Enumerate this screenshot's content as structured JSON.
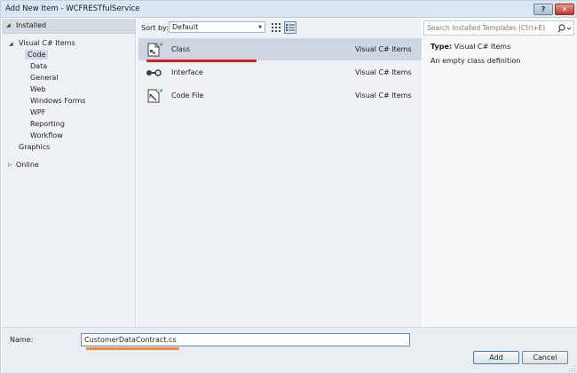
{
  "window": {
    "title": "Add New Item - WCFRESTfulService",
    "help_glyph": "?",
    "close_glyph": "✕"
  },
  "tree": {
    "root": "Installed",
    "items": [
      {
        "label": "Visual C# Items",
        "level": 1,
        "expanded": true
      },
      {
        "label": "Code",
        "level": 2,
        "selected": true
      },
      {
        "label": "Data",
        "level": 2
      },
      {
        "label": "General",
        "level": 2
      },
      {
        "label": "Web",
        "level": 2
      },
      {
        "label": "Windows Forms",
        "level": 2
      },
      {
        "label": "WPF",
        "level": 2
      },
      {
        "label": "Reporting",
        "level": 2
      },
      {
        "label": "Workflow",
        "level": 2
      },
      {
        "label": "Graphics",
        "level": 1
      }
    ],
    "online": "Online"
  },
  "sort": {
    "label": "Sort by:",
    "value": "Default",
    "view_mode": "list"
  },
  "templates": [
    {
      "name": "Class",
      "type": "Visual C# Items",
      "icon": "class-icon",
      "selected": true
    },
    {
      "name": "Interface",
      "type": "Visual C# Items",
      "icon": "interface-icon",
      "selected": false
    },
    {
      "name": "Code File",
      "type": "Visual C# Items",
      "icon": "code-file-icon",
      "selected": false
    }
  ],
  "search": {
    "placeholder": "Search Installed Templates (Ctrl+E)"
  },
  "details": {
    "type_label": "Type:",
    "type_value": "Visual C# Items",
    "description": "An empty class definition"
  },
  "name_field": {
    "label": "Name:",
    "value": "CustomerDataContract.cs"
  },
  "buttons": {
    "add": "Add",
    "cancel": "Cancel"
  },
  "colors": {
    "title_bar": "#d9e7f4",
    "selection": "#cdd6e2",
    "annotation_red": "#d21f24",
    "annotation_orange": "#ef8a3a",
    "focus_border": "#5b8dc9"
  }
}
